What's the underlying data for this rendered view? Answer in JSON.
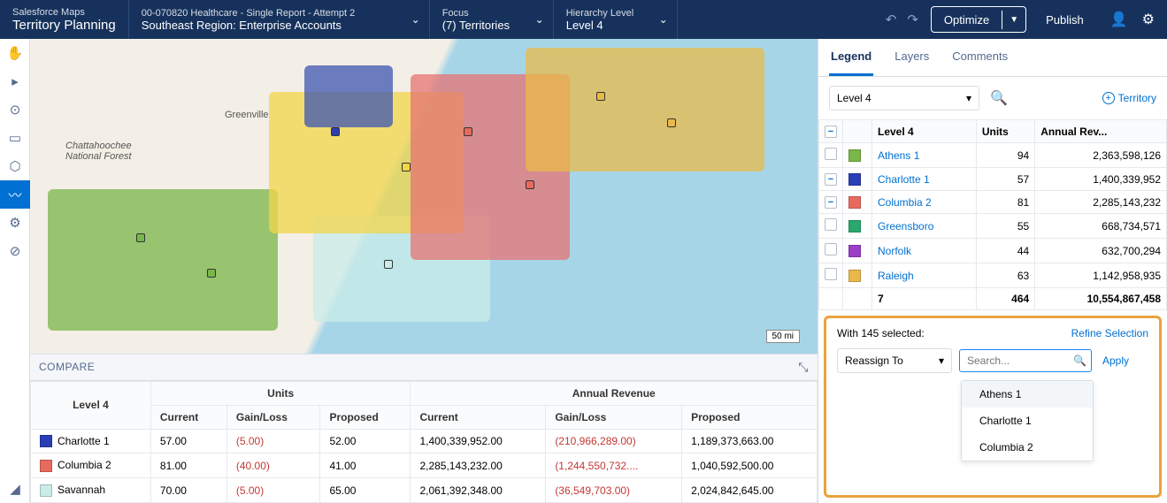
{
  "header": {
    "app_small": "Salesforce Maps",
    "app_big": "Territory Planning",
    "dataset_small": "00-070820 Healthcare - Single Report - Attempt 2",
    "dataset_big": "Southeast Region: Enterprise Accounts",
    "focus_label": "Focus",
    "focus_value": "(7) Territories",
    "hierarchy_label": "Hierarchy Level",
    "hierarchy_value": "Level 4",
    "optimize": "Optimize",
    "publish": "Publish"
  },
  "map": {
    "city1": "Greenville",
    "forest": "Chattahoochee\nNational Forest",
    "scale": "50 mi"
  },
  "compare": {
    "title": "COMPARE",
    "group1": "Units",
    "group2": "Annual Revenue",
    "h_level": "Level 4",
    "h_current": "Current",
    "h_gl": "Gain/Loss",
    "h_proposed": "Proposed",
    "rows": [
      {
        "color": "#2a3fb5",
        "name": "Charlotte 1",
        "u_cur": "57.00",
        "u_gl": "(5.00)",
        "u_prop": "52.00",
        "r_cur": "1,400,339,952.00",
        "r_gl": "(210,966,289.00)",
        "r_prop": "1,189,373,663.00"
      },
      {
        "color": "#e86a5f",
        "name": "Columbia 2",
        "u_cur": "81.00",
        "u_gl": "(40.00)",
        "u_prop": "41.00",
        "r_cur": "2,285,143,232.00",
        "r_gl": "(1,244,550,732....",
        "r_prop": "1,040,592,500.00"
      },
      {
        "color": "#c9ece8",
        "name": "Savannah",
        "u_cur": "70.00",
        "u_gl": "(5.00)",
        "u_prop": "65.00",
        "r_cur": "2,061,392,348.00",
        "r_gl": "(36,549,703.00)",
        "r_prop": "2,024,842,645.00"
      }
    ]
  },
  "sidebar": {
    "tabs": {
      "legend": "Legend",
      "layers": "Layers",
      "comments": "Comments"
    },
    "level_dd": "Level 4",
    "add_territory": "Territory",
    "cols": {
      "level": "Level 4",
      "units": "Units",
      "rev": "Annual Rev..."
    },
    "rows": [
      {
        "chk": "",
        "color": "#7ab648",
        "name": "Athens 1",
        "units": "94",
        "rev": "2,363,598,126"
      },
      {
        "chk": "minus",
        "color": "#2a3fb5",
        "name": "Charlotte 1",
        "units": "57",
        "rev": "1,400,339,952"
      },
      {
        "chk": "minus",
        "color": "#e86a5f",
        "name": "Columbia 2",
        "units": "81",
        "rev": "2,285,143,232"
      },
      {
        "chk": "",
        "color": "#2aa86f",
        "name": "Greensboro",
        "units": "55",
        "rev": "668,734,571"
      },
      {
        "chk": "",
        "color": "#9b3fc9",
        "name": "Norfolk",
        "units": "44",
        "rev": "632,700,294"
      },
      {
        "chk": "",
        "color": "#e8b94a",
        "name": "Raleigh",
        "units": "63",
        "rev": "1,142,958,935"
      }
    ],
    "totals": {
      "count": "7",
      "units": "464",
      "rev": "10,554,867,458"
    }
  },
  "selection": {
    "with_label": "With 145 selected:",
    "refine": "Refine Selection",
    "reassign": "Reassign To",
    "search_ph": "Search...",
    "apply": "Apply",
    "options": [
      "Athens 1",
      "Charlotte 1",
      "Columbia 2"
    ]
  }
}
